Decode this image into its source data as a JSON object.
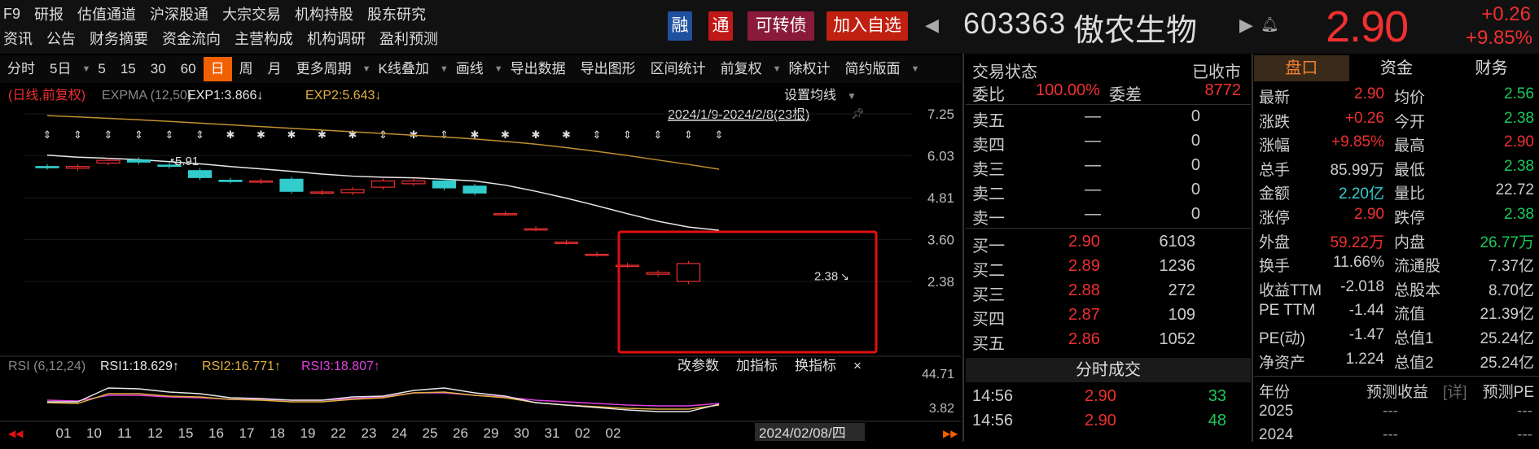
{
  "nav": {
    "row1": [
      "F9",
      "研报",
      "估值通道",
      "沪深股通",
      "大宗交易",
      "机构持股",
      "股东研究"
    ],
    "row2": [
      "资讯",
      "公告",
      "财务摘要",
      "资金流向",
      "主营构成",
      "机构调研",
      "盈利预测"
    ]
  },
  "badges": {
    "rong": "融",
    "tong": "通",
    "convertible": "可转债",
    "add_watch": "加入自选"
  },
  "stock": {
    "code": "603363",
    "name": "傲农生物",
    "price": "2.90",
    "change": "+0.26",
    "change_pct": "+9.85%"
  },
  "toolbar": [
    "分时",
    "5日",
    "5",
    "15",
    "30",
    "60",
    "日",
    "周",
    "月",
    "更多周期",
    "K线叠加",
    "画线",
    "导出数据",
    "导出图形",
    "区间统计",
    "前复权",
    "除权计",
    "简约版面"
  ],
  "chart": {
    "header_label": "(日线,前复权)",
    "expma": "EXPMA (12,50)",
    "exp1": "EXP1:3.866↓",
    "exp2": "EXP2:5.643↓",
    "setting": "设置均线",
    "range": "2024/1/9-2024/2/8(23根)",
    "y_ticks": [
      "7.25",
      "6.03",
      "4.81",
      "3.60",
      "2.38"
    ],
    "high_label": "5.91",
    "low_label": "2.38",
    "rsi_label": "RSI (6,12,24)",
    "rsi1": "RSI1:18.629↑",
    "rsi2": "RSI2:16.771↑",
    "rsi3": "RSI3:18.807↑",
    "rsi_buttons": [
      "改参数",
      "加指标",
      "换指标",
      "×"
    ],
    "rsi_ticks": [
      "44.71",
      "3.82"
    ],
    "x_ticks": [
      "01",
      "10",
      "11",
      "12",
      "15",
      "16",
      "17",
      "18",
      "19",
      "22",
      "23",
      "24",
      "25",
      "26",
      "29",
      "30",
      "31",
      "02",
      "02"
    ],
    "cursor_date": "2024/02/08/四"
  },
  "chart_data": {
    "type": "candlestick",
    "dates": [
      "1/9",
      "1/10",
      "1/11",
      "1/12",
      "1/15",
      "1/16",
      "1/17",
      "1/18",
      "1/19",
      "1/22",
      "1/23",
      "1/24",
      "1/25",
      "1/26",
      "1/29",
      "1/30",
      "1/31",
      "2/1",
      "2/2",
      "2/5",
      "2/6",
      "2/7",
      "2/8"
    ],
    "open": [
      5.72,
      5.67,
      5.82,
      5.91,
      5.76,
      5.6,
      5.32,
      5.28,
      5.35,
      4.96,
      4.96,
      5.12,
      5.22,
      5.3,
      5.15,
      4.35,
      3.91,
      3.52,
      3.17,
      2.85,
      2.59,
      2.38
    ],
    "close": [
      5.7,
      5.72,
      5.9,
      5.85,
      5.73,
      5.4,
      5.3,
      5.3,
      5.0,
      4.98,
      5.05,
      5.3,
      5.3,
      5.1,
      4.95,
      4.35,
      3.91,
      3.52,
      3.17,
      2.85,
      2.64,
      2.9
    ],
    "exp1": [
      6.05,
      5.99,
      5.96,
      5.92,
      5.86,
      5.8,
      5.72,
      5.65,
      5.58,
      5.5,
      5.44,
      5.41,
      5.39,
      5.35,
      5.3,
      5.18,
      5.0,
      4.8,
      4.58,
      4.35,
      4.13,
      3.96,
      3.866
    ],
    "exp2": [
      7.2,
      7.16,
      7.12,
      7.08,
      7.03,
      6.98,
      6.93,
      6.88,
      6.83,
      6.78,
      6.73,
      6.68,
      6.63,
      6.58,
      6.52,
      6.45,
      6.37,
      6.27,
      6.16,
      6.04,
      5.91,
      5.78,
      5.643
    ],
    "ylim": [
      2.38,
      7.25
    ]
  },
  "orderbook": {
    "status_label": "交易状态",
    "status_value": "已收市",
    "weibi_label": "委比",
    "weibi_value": "100.00%",
    "weicha_label": "委差",
    "weicha_value": "8772",
    "asks": [
      {
        "label": "卖五",
        "price": "—",
        "vol": "0"
      },
      {
        "label": "卖四",
        "price": "—",
        "vol": "0"
      },
      {
        "label": "卖三",
        "price": "—",
        "vol": "0"
      },
      {
        "label": "卖二",
        "price": "—",
        "vol": "0"
      },
      {
        "label": "卖一",
        "price": "—",
        "vol": "0"
      }
    ],
    "bids": [
      {
        "label": "买一",
        "price": "2.90",
        "vol": "6103"
      },
      {
        "label": "买二",
        "price": "2.89",
        "vol": "1236"
      },
      {
        "label": "买三",
        "price": "2.88",
        "vol": "272"
      },
      {
        "label": "买四",
        "price": "2.87",
        "vol": "109"
      },
      {
        "label": "买五",
        "price": "2.86",
        "vol": "1052"
      }
    ],
    "ticks_title": "分时成交",
    "ticks": [
      {
        "time": "14:56",
        "price": "2.90",
        "vol": "33"
      },
      {
        "time": "14:56",
        "price": "2.90",
        "vol": "48"
      }
    ]
  },
  "quote": {
    "tabs": [
      "盘口",
      "资金",
      "财务"
    ],
    "rows": [
      [
        "最新",
        "2.90",
        "均价",
        "2.56"
      ],
      [
        "涨跌",
        "+0.26",
        "今开",
        "2.38"
      ],
      [
        "涨幅",
        "+9.85%",
        "最高",
        "2.90"
      ],
      [
        "总手",
        "85.99万",
        "最低",
        "2.38"
      ],
      [
        "金额",
        "2.20亿",
        "量比",
        "22.72"
      ],
      [
        "涨停",
        "2.90",
        "跌停",
        "2.38"
      ],
      [
        "外盘",
        "59.22万",
        "内盘",
        "26.77万"
      ],
      [
        "换手",
        "11.66%",
        "流通股",
        "7.37亿"
      ],
      [
        "收益TTM",
        "-2.018",
        "总股本",
        "8.70亿"
      ],
      [
        "PE TTM",
        "-1.44",
        "流值",
        "21.39亿"
      ],
      [
        "PE(动)",
        "-1.47",
        "总值1",
        "25.24亿"
      ],
      [
        "净资产",
        "1.224",
        "总值2",
        "25.24亿"
      ]
    ],
    "forecast_header": [
      "年份",
      "预测收益",
      "[详]",
      "预测PE"
    ],
    "forecast": [
      [
        "2025",
        "---",
        "---"
      ],
      [
        "2024",
        "---",
        "---"
      ]
    ]
  },
  "colors": {
    "up": "#f03030",
    "down": "#33cccc",
    "accent": "#f06000",
    "highlight_box": "#e01010"
  }
}
